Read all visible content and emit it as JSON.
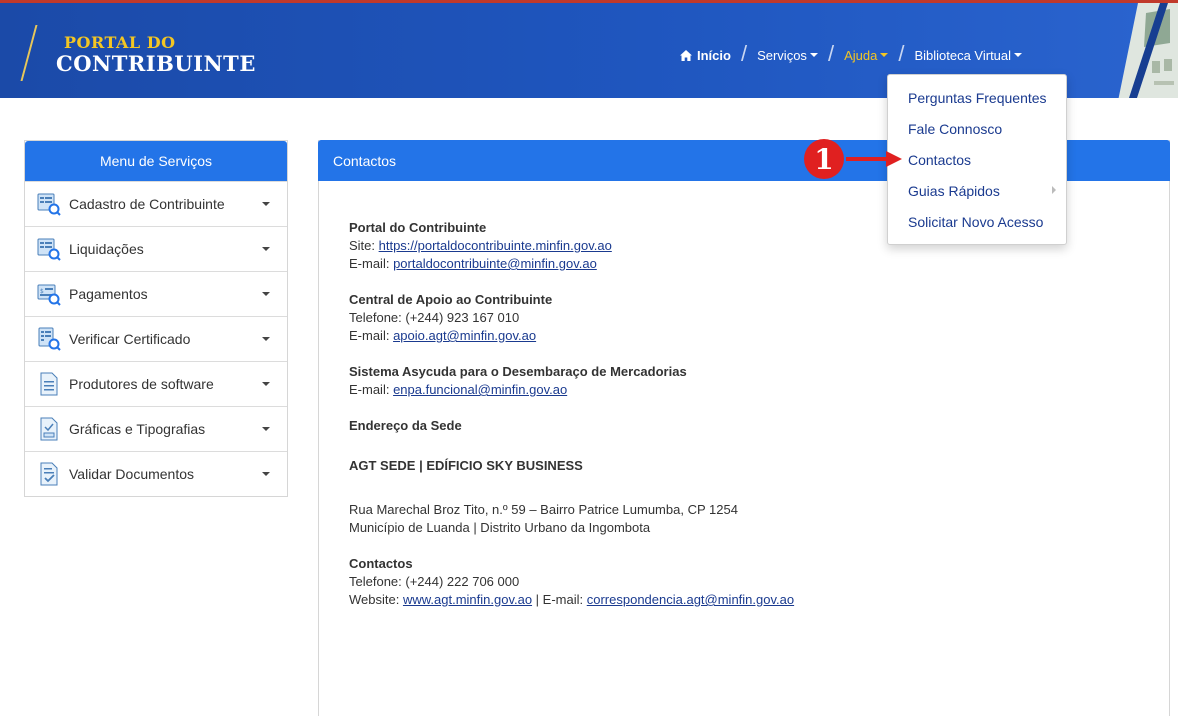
{
  "header": {
    "logo_line1": "PORTAL DO",
    "logo_line2": "CONTRIBUINTE",
    "nav": {
      "inicio": "Início",
      "servicos": "Serviços",
      "ajuda": "Ajuda",
      "biblioteca": "Biblioteca Virtual"
    },
    "colors": {
      "bar": "#1f56bf",
      "accent": "#f3c623",
      "top_border": "#c0392b"
    }
  },
  "dropdown": {
    "items": [
      "Perguntas Frequentes",
      "Fale Connosco",
      "Contactos",
      "Guias Rápidos",
      "Solicitar Novo Acesso"
    ]
  },
  "annotation": {
    "number": "1"
  },
  "sidebar": {
    "title": "Menu de Serviços",
    "items": [
      {
        "label": "Cadastro de Contribuinte",
        "icon": "register-search-icon"
      },
      {
        "label": "Liquidações",
        "icon": "register-search-icon"
      },
      {
        "label": "Pagamentos",
        "icon": "payment-search-icon"
      },
      {
        "label": "Verificar Certificado",
        "icon": "certificate-search-icon"
      },
      {
        "label": "Produtores de software",
        "icon": "document-list-icon"
      },
      {
        "label": "Gráficas e Tipografias",
        "icon": "print-document-icon"
      },
      {
        "label": "Validar Documentos",
        "icon": "document-check-icon"
      }
    ]
  },
  "main": {
    "title": "Contactos",
    "portal": {
      "title": "Portal do Contribuinte",
      "site_label": "Site: ",
      "site_url": "https://portaldocontribuinte.minfin.gov.ao",
      "email_label": "E-mail: ",
      "email": "portaldocontribuinte@minfin.gov.ao"
    },
    "central": {
      "title": "Central de Apoio ao Contribuinte",
      "phone": "Telefone: (+244) 923 167 010",
      "email_label": "E-mail: ",
      "email": "apoio.agt@minfin.gov.ao"
    },
    "asycuda": {
      "title": "Sistema Asycuda para o Desembaraço de Mercadorias",
      "email_label": "E-mail: ",
      "email": "enpa.funcional@minfin.gov.ao"
    },
    "sede": {
      "title": "Endereço da Sede",
      "building": "AGT SEDE | EDÍFICIO SKY BUSINESS",
      "address1": "Rua Marechal Broz Tito, n.º 59 – Bairro Patrice Lumumba, CP 1254",
      "address2": "Município de Luanda | Distrito Urbano da Ingombota"
    },
    "contactos": {
      "title": "Contactos",
      "phone": "Telefone: (+244) 222 706 000",
      "website_label": "Website: ",
      "website": "www.agt.minfin.gov.ao",
      "sep": " | E-mail: ",
      "email": "correspondencia.agt@minfin.gov.ao"
    }
  }
}
